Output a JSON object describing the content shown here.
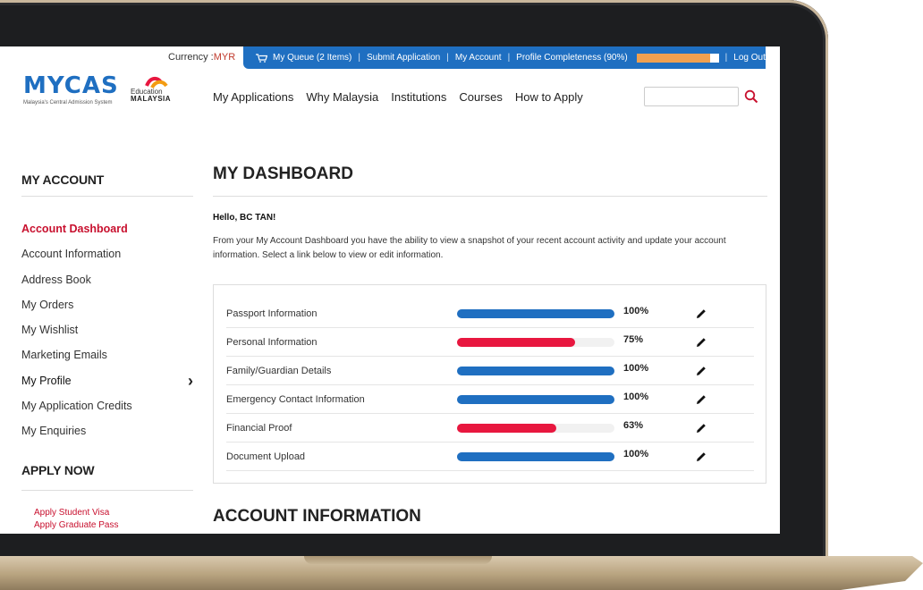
{
  "colors": {
    "primary_blue": "#1f6fc1",
    "accent_red": "#c8102e",
    "bar_blue": "#1f6fc1",
    "bar_red": "#e8173f",
    "completeness_orange": "#f0a050"
  },
  "topbar": {
    "currency_label": "Currency :",
    "currency_value": "MYR",
    "queue": "My Queue (2 Items)",
    "submit": "Submit Application",
    "account": "My Account",
    "completeness": "Profile Completeness (90%)",
    "completeness_value": 0.9,
    "logout": "Log Out"
  },
  "logo": {
    "main": "MYCAS",
    "sub": "Malaysia's Central Admission System",
    "edu_line1": "Education",
    "edu_line2": "MALAYSIA"
  },
  "nav": {
    "items": [
      "My Applications",
      "Why Malaysia",
      "Institutions",
      "Courses",
      "How to Apply"
    ]
  },
  "sidebar": {
    "heading": "MY ACCOUNT",
    "items": [
      {
        "label": "Account Dashboard"
      },
      {
        "label": "Account Information"
      },
      {
        "label": "Address Book"
      },
      {
        "label": "My Orders"
      },
      {
        "label": "My Wishlist"
      },
      {
        "label": "Marketing Emails"
      },
      {
        "label": "My Profile"
      },
      {
        "label": "My Application Credits"
      },
      {
        "label": "My Enquiries"
      }
    ],
    "apply_heading": "APPLY NOW",
    "apply_items": [
      "Apply Student Visa",
      "Apply Graduate Pass"
    ]
  },
  "main": {
    "title": "MY DASHBOARD",
    "greeting": "Hello, BC TAN!",
    "intro": "From your My Account Dashboard you have the ability to view a snapshot of your recent account activity and update your account information. Select a link below to view or edit information.",
    "sections": [
      {
        "label": "Passport Information",
        "percent": "100%",
        "value": 100,
        "status": "complete"
      },
      {
        "label": "Personal Information",
        "percent": "75%",
        "value": 75,
        "status": "incomplete"
      },
      {
        "label": "Family/Guardian Details",
        "percent": "100%",
        "value": 100,
        "status": "complete"
      },
      {
        "label": "Emergency Contact Information",
        "percent": "100%",
        "value": 100,
        "status": "complete"
      },
      {
        "label": "Financial Proof",
        "percent": "63%",
        "value": 63,
        "status": "incomplete"
      },
      {
        "label": "Document Upload",
        "percent": "100%",
        "value": 100,
        "status": "complete"
      }
    ],
    "account_info_title": "ACCOUNT INFORMATION"
  }
}
